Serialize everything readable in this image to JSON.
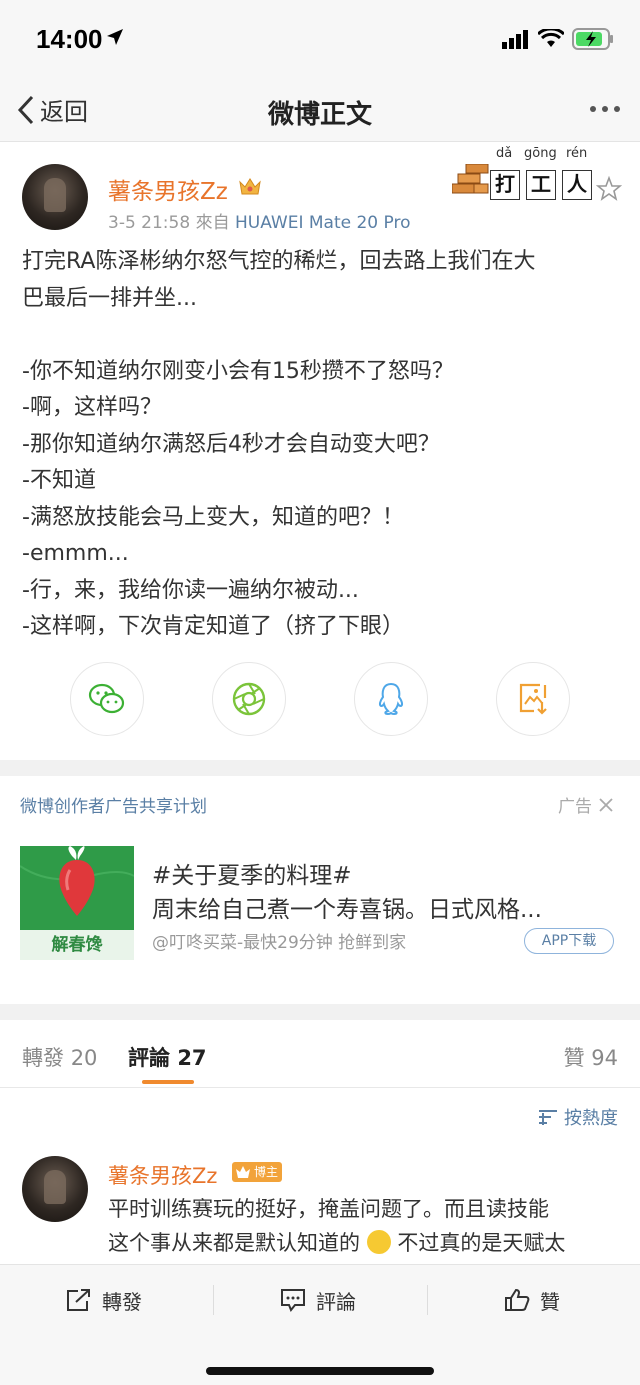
{
  "status_bar": {
    "time": "14:00"
  },
  "nav": {
    "back_label": "返回",
    "title": "微博正文"
  },
  "post": {
    "author": "薯条男孩Zz",
    "date": "3-5 21:58",
    "source_prefix": "來自",
    "source": "HUAWEI Mate 20 Pro",
    "badge": {
      "pinyin": [
        "dǎ",
        "gōng",
        "rén"
      ],
      "chars": [
        "打",
        "工",
        "人"
      ]
    },
    "lines": [
      "打完RA陈泽彬纳尔怒气控的稀烂，回去路上我们在大",
      "巴最后一排并坐...",
      "",
      "-你不知道纳尔刚变小会有15秒攒不了怒吗？",
      "-啊，这样吗？",
      "-那你知道纳尔满怒后4秒才会自动变大吧？",
      "-不知道",
      "-满怒放技能会马上变大，知道的吧？！",
      "-emmm...",
      "-行，来，我给你读一遍纳尔被动...",
      "-这样啊，下次肯定知道了（挤了下眼）"
    ]
  },
  "share_icons": [
    "wechat-icon",
    "moments-icon",
    "qq-icon",
    "save-image-icon"
  ],
  "ad": {
    "header": "微博创作者广告共享计划",
    "tag": "广告",
    "thumb_label": "解春馋",
    "title": "#关于夏季的料理#",
    "desc": "周末给自己煮一个寿喜锅。日式风格...",
    "source": "@叮咚买菜-最快29分钟 抢鲜到家",
    "button": "APP下载",
    "accent": "#2f9b48"
  },
  "tabs": {
    "repost_label": "轉發",
    "repost_count": "20",
    "comment_label": "評論",
    "comment_count": "27",
    "like_label": "贊",
    "like_count": "94"
  },
  "sort_label": "按熱度",
  "comment": {
    "author": "薯条男孩Zz",
    "badge": "博主",
    "line1": "平时训练赛玩的挺好，掩盖问题了。而且读技能",
    "line2a": "这个事从来都是默认知道的",
    "line2b": "不过真的是天赋太"
  },
  "bottom_bar": {
    "repost": "轉發",
    "comment": "評論",
    "like": "贊"
  },
  "colors": {
    "author": "#e8742b",
    "link": "#5a7fa5",
    "accent": "#f08a2e"
  }
}
